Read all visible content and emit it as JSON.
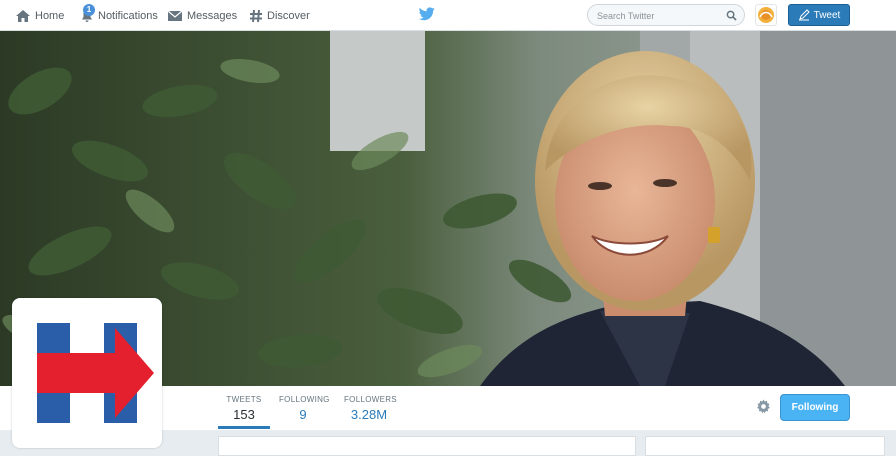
{
  "topbar": {
    "nav": [
      {
        "label": "Home",
        "icon": "home-icon"
      },
      {
        "label": "Notifications",
        "icon": "bell-icon",
        "badge": "1"
      },
      {
        "label": "Messages",
        "icon": "envelope-icon"
      },
      {
        "label": "Discover",
        "icon": "hashtag-icon"
      }
    ],
    "logo_icon": "twitter-bird-icon",
    "search_placeholder": "Search Twitter",
    "tweet_label": "Tweet"
  },
  "profile_nav": {
    "stats": [
      {
        "label": "TWEETS",
        "value": "153"
      },
      {
        "label": "FOLLOWING",
        "value": "9"
      },
      {
        "label": "FOLLOWERS",
        "value": "3.28M"
      }
    ],
    "follow_label": "Following"
  },
  "colors": {
    "twitter_blue": "#55acee",
    "tweet_button": "#2b7bb9",
    "follow_button": "#4ab3f4",
    "logo_red": "#e4202f",
    "logo_blue": "#2a5ea8"
  }
}
